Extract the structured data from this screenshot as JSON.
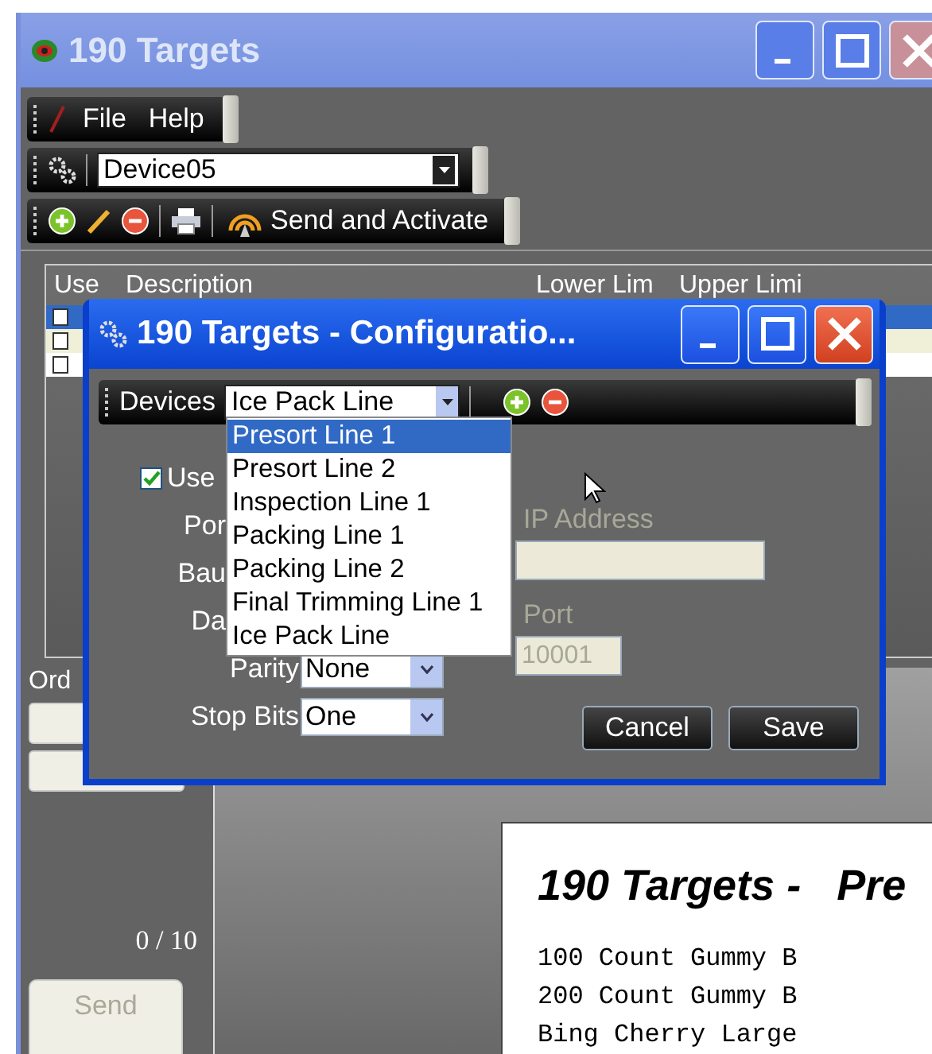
{
  "main_window": {
    "title": "190 Targets",
    "menu": [
      "File",
      "Help"
    ],
    "device_select": {
      "value": "Device05"
    },
    "send_activate_button": "Send and Activate",
    "grid": {
      "columns": [
        "Use",
        "Description",
        "Lower Lim",
        "Upper Limi"
      ],
      "rows": [
        {
          "selected": true
        },
        {
          "selected": false
        },
        {
          "selected": false
        }
      ]
    },
    "order_label": "Ord",
    "counter": "0 / 10",
    "send_items_button": {
      "label": "Send",
      "disabled": true
    },
    "preview": {
      "heading": "190 Targets -   Pre",
      "lines": [
        "100 Count Gummy B",
        "200 Count Gummy B",
        "Bing Cherry Large"
      ]
    }
  },
  "dialog": {
    "title": "190 Targets - Configuratio...",
    "devices_label": "Devices",
    "devices_select": {
      "value": "Ice Pack Line",
      "expanded": true
    },
    "dropdown_items": [
      {
        "label": "Presort Line 1",
        "selected": true
      },
      {
        "label": "Presort Line 2",
        "selected": false
      },
      {
        "label": "Inspection Line 1",
        "selected": false
      },
      {
        "label": "Packing Line 1",
        "selected": false
      },
      {
        "label": "Packing Line 2",
        "selected": false
      },
      {
        "label": "Final Trimming Line 1",
        "selected": false
      },
      {
        "label": "Ice Pack Line",
        "selected": false
      }
    ],
    "use_checkbox": {
      "label": "Use",
      "checked": true
    },
    "fields": [
      {
        "kind": "partial",
        "label": "Por"
      },
      {
        "kind": "partial",
        "label": "Bau"
      },
      {
        "kind": "partial",
        "label": "Da"
      },
      {
        "kind": "combo",
        "label": "Parity",
        "value": "None"
      },
      {
        "kind": "combo",
        "label": "Stop Bits",
        "value": "One"
      }
    ],
    "ip_address": {
      "label": "IP Address",
      "disabled": true
    },
    "port": {
      "label": "Port",
      "value": "10001",
      "disabled": true
    },
    "buttons": [
      "Cancel",
      "Save"
    ]
  }
}
